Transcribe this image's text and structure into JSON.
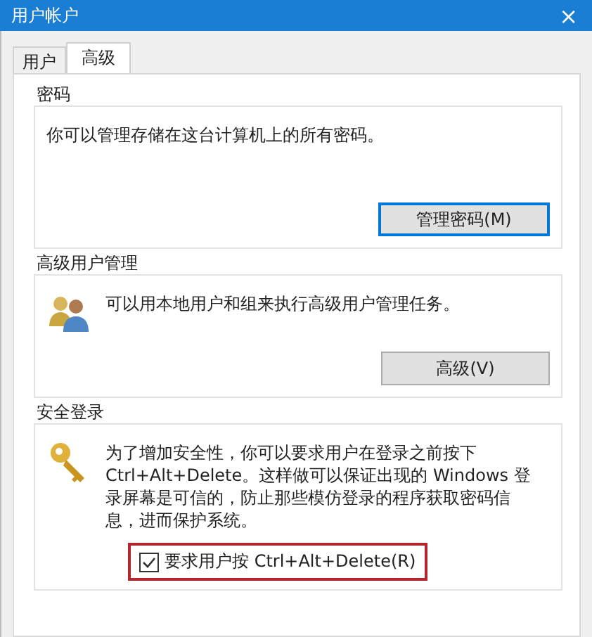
{
  "window": {
    "title": "用户帐户",
    "close": "×"
  },
  "tabs": [
    {
      "label": "用户",
      "selected": false
    },
    {
      "label": "高级",
      "selected": true
    }
  ],
  "groups": [
    {
      "kind": "password",
      "title": "密码",
      "text": "你可以管理存储在这台计算机上的所有密码。",
      "button": {
        "label": "管理密码(M)",
        "default": true
      }
    },
    {
      "kind": "users",
      "title": "高级用户管理",
      "text": "可以用本地用户和组来执行高级用户管理任务。",
      "button": {
        "label": "高级(V)",
        "default": false
      }
    },
    {
      "kind": "secure",
      "title": "安全登录",
      "text": "为了增加安全性，你可以要求用户在登录之前按下 Ctrl+Alt+Delete。这样做可以保证出现的 Windows 登录屏幕是可信的，防止那些模仿登录的程序获取密码信息，进而保护系统。",
      "checkbox": {
        "label": "要求用户按 Ctrl+Alt+Delete(R)",
        "checked": true,
        "highlighted": true
      }
    }
  ]
}
